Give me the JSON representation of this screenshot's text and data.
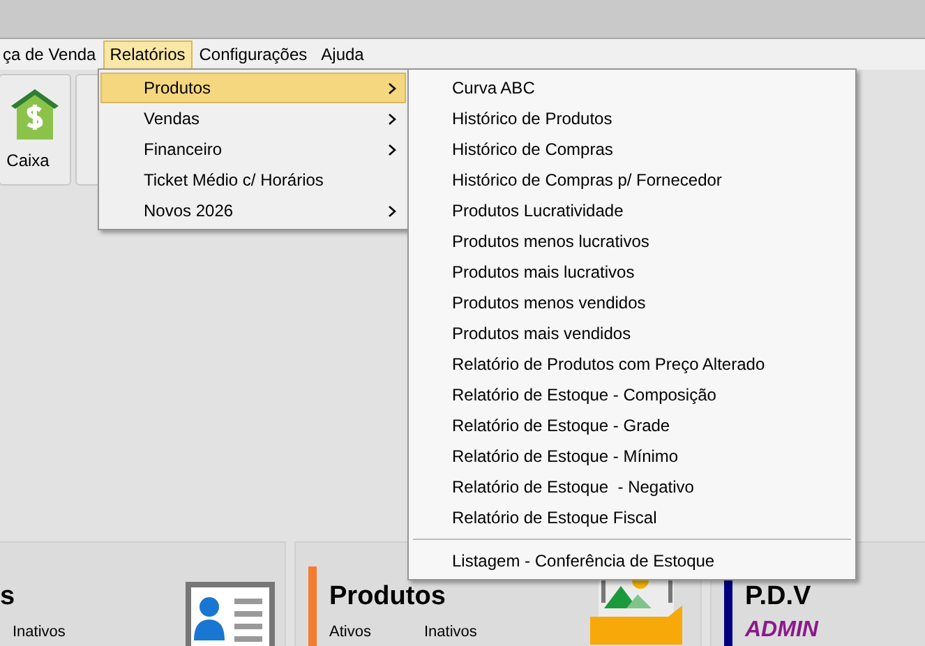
{
  "menubar": [
    {
      "label": "ça de Venda",
      "selected": false
    },
    {
      "label": "Relatórios",
      "selected": true
    },
    {
      "label": "Configurações",
      "selected": false
    },
    {
      "label": "Ajuda",
      "selected": false
    }
  ],
  "toolbar": [
    {
      "label": "Caixa"
    }
  ],
  "menu": [
    {
      "label": "Produtos",
      "selected": true,
      "submenu": true
    },
    {
      "label": "Vendas",
      "selected": false,
      "submenu": true
    },
    {
      "label": "Financeiro",
      "selected": false,
      "submenu": true
    },
    {
      "label": "Ticket Médio c/ Horários",
      "selected": false,
      "submenu": false
    },
    {
      "label": "Novos 2026",
      "selected": false,
      "submenu": true
    }
  ],
  "submenu": [
    {
      "kind": "item",
      "label": "Curva ABC"
    },
    {
      "kind": "item",
      "label": "Histórico de Produtos"
    },
    {
      "kind": "item",
      "label": "Histórico de Compras"
    },
    {
      "kind": "item",
      "label": "Histórico de Compras p/ Fornecedor"
    },
    {
      "kind": "item",
      "label": "Produtos Lucratividade"
    },
    {
      "kind": "item",
      "label": "Produtos menos lucrativos"
    },
    {
      "kind": "item",
      "label": "Produtos mais lucrativos"
    },
    {
      "kind": "item",
      "label": "Produtos menos vendidos"
    },
    {
      "kind": "item",
      "label": "Produtos mais vendidos"
    },
    {
      "kind": "item",
      "label": "Relatório de Produtos com Preço Alterado"
    },
    {
      "kind": "item",
      "label": "Relatório de Estoque - Composição"
    },
    {
      "kind": "item",
      "label": "Relatório de Estoque - Grade"
    },
    {
      "kind": "item",
      "label": "Relatório de Estoque - Mínimo"
    },
    {
      "kind": "item",
      "label": "Relatório de Estoque  - Negativo"
    },
    {
      "kind": "item",
      "label": "Relatório de Estoque Fiscal"
    },
    {
      "kind": "separator"
    },
    {
      "kind": "item",
      "label": "Listagem - Conferência de Estoque"
    }
  ],
  "cards": [
    {
      "title": "s",
      "labels": [
        "Inativos"
      ]
    },
    {
      "title": "Produtos",
      "color": "#f47b30",
      "labels": [
        "Ativos",
        "Inativos"
      ]
    },
    {
      "title": "P.D.V",
      "color": "#000080",
      "subtitle": "ADMIN"
    }
  ]
}
